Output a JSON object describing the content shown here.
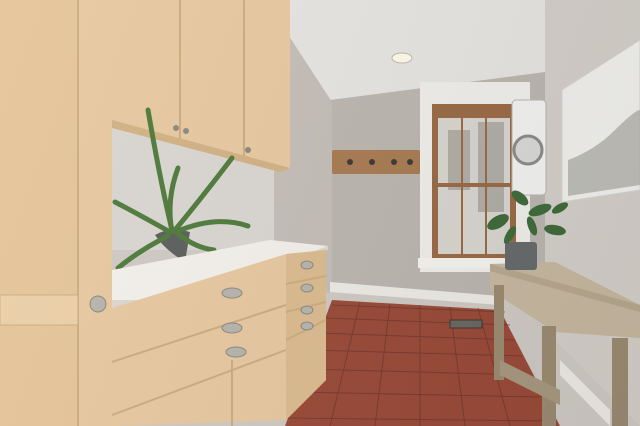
{
  "scene": {
    "kind": "interior-photo",
    "room": "laundry-mudroom",
    "palette": {
      "cabinet": "#e8c9a0",
      "cabinet_shadow": "#d3b184",
      "countertop": "#f4f1ec",
      "wall": "#bcb6b0",
      "ceiling": "#e7e5e1",
      "floor_tile": "#9a4a38",
      "grout": "#5b2f26",
      "baseboard": "#eeebe6",
      "window_trim": "#f1efeb",
      "window_sash": "#9a6a45",
      "coat_rack": "#a87b52",
      "console_table": "#b8a88f",
      "plant_green": "#3f6a3a",
      "hardware": "#b8b4ad"
    },
    "icons": [
      "aloe-plant-icon",
      "potted-plant-icon",
      "recessed-light-icon",
      "floor-vent-icon"
    ]
  }
}
